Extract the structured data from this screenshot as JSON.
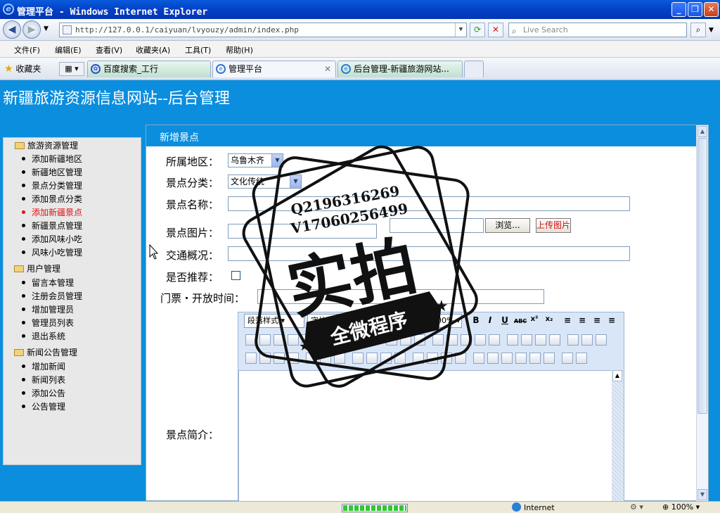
{
  "window": {
    "title": "管理平台 - Windows Internet Explorer",
    "address": "http://127.0.0.1/caiyuan/lvyouzy/admin/index.php",
    "search_placeholder": "Live Search"
  },
  "menu": [
    "文件(F)",
    "编辑(E)",
    "查看(V)",
    "收藏夹(A)",
    "工具(T)",
    "帮助(H)"
  ],
  "favorites_label": "收藏夹",
  "tabs": [
    {
      "label": "百度搜索_工行"
    },
    {
      "label": "管理平台",
      "active": true
    },
    {
      "label": "后台管理-新疆旅游网站..."
    }
  ],
  "page": {
    "title": "新疆旅游资源信息网站--后台管理"
  },
  "sidebar": {
    "groups": [
      {
        "label": "旅游资源管理",
        "items": [
          "添加新疆地区",
          "新疆地区管理",
          "景点分类管理",
          "添加景点分类",
          "添加新疆景点",
          "新疆景点管理",
          "添加风味小吃",
          "风味小吃管理"
        ]
      },
      {
        "label": "用户管理",
        "items": [
          "留言本管理",
          "注册会员管理",
          "增加管理员",
          "管理员列表",
          "退出系统"
        ]
      },
      {
        "label": "新闻公告管理",
        "items": [
          "增加新闻",
          "新闻列表",
          "添加公告",
          "公告管理"
        ]
      }
    ],
    "active_item": "添加新疆景点"
  },
  "form": {
    "heading": "新增景点",
    "region_label": "所属地区：",
    "region_value": "乌鲁木齐",
    "category_label": "景点分类：",
    "category_value": "文化传统",
    "name_label": "景点名称：",
    "image_label": "景点图片：",
    "browse_button": "浏览...",
    "upload_button": "上传图片",
    "traffic_label": "交通概况：",
    "recommend_label": "是否推荐：",
    "ticket_label": "门票・开放时间：",
    "intro_label": "景点简介："
  },
  "editor": {
    "paragraph_style": "段落样式",
    "font": "字体",
    "size": "100%",
    "format_buttons": [
      "B",
      "I",
      "U",
      "ABC",
      "x²",
      "x₂"
    ]
  },
  "watermark": {
    "line1": "Q2196316269",
    "line2": "V17060256499",
    "big": "实拍",
    "banner": "全微程序"
  },
  "status": {
    "zone": "Internet",
    "zoom": "100%",
    "progress": 1.0
  }
}
